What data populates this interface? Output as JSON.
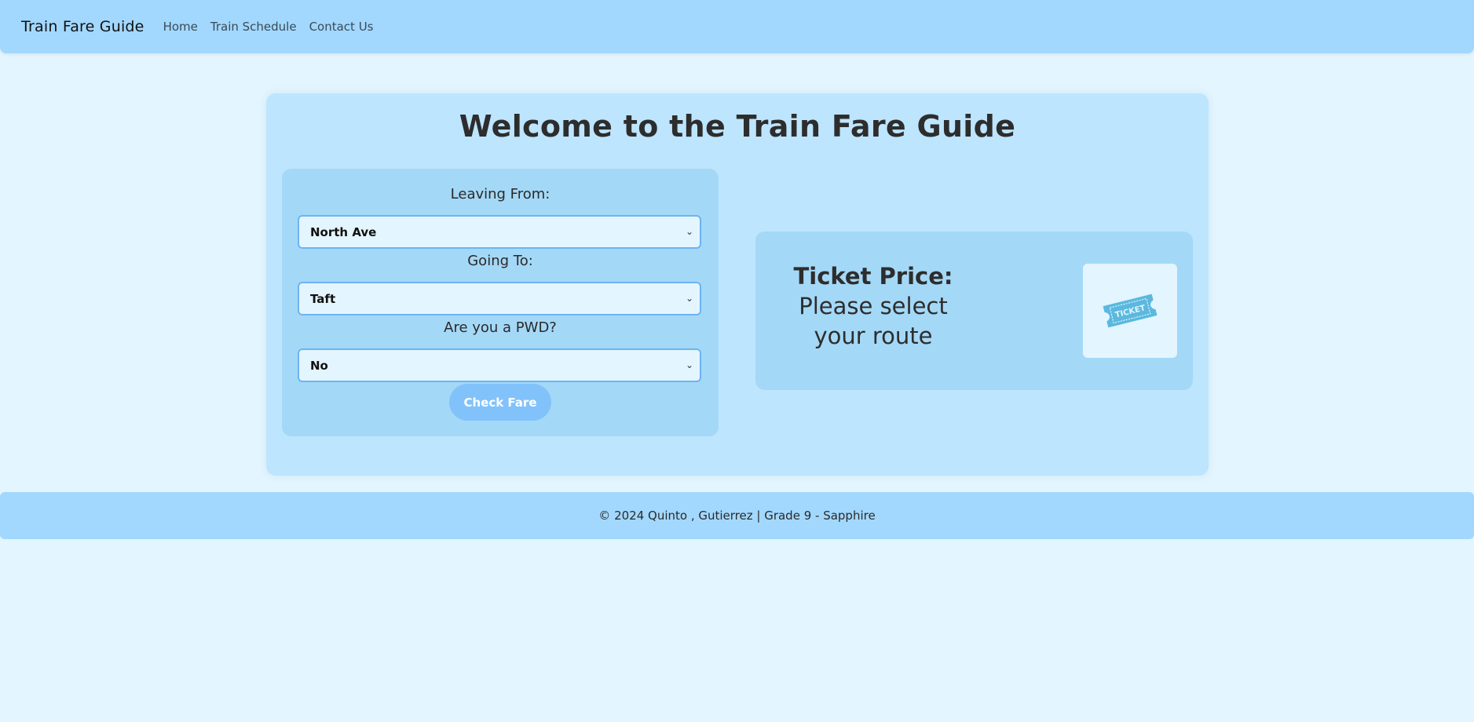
{
  "navbar": {
    "brand": "Train Fare Guide",
    "links": [
      "Home",
      "Train Schedule",
      "Contact Us"
    ]
  },
  "main": {
    "title": "Welcome to the Train Fare Guide",
    "form": {
      "leaving_label": "Leaving From:",
      "leaving_value": "North Ave",
      "going_label": "Going To:",
      "going_value": "Taft",
      "pwd_label": "Are you a PWD?",
      "pwd_value": "No",
      "submit_label": "Check Fare"
    },
    "ticket": {
      "label": "Ticket Price:",
      "value": "Please select your route",
      "image_icon": "ticket-icon",
      "image_text": "TICKET"
    }
  },
  "footer": {
    "text": "© 2024 Quinto , Gutierrez | Grade 9 - Sapphire"
  },
  "colors": {
    "background": "#e3f5fe",
    "navbar": "#a2d8fe",
    "card": "#bde5fe",
    "panel": "#a4d8f7",
    "select_border": "#6cb4f4",
    "button": "#82c2fb",
    "ticket_icon": "#5bb8de"
  }
}
